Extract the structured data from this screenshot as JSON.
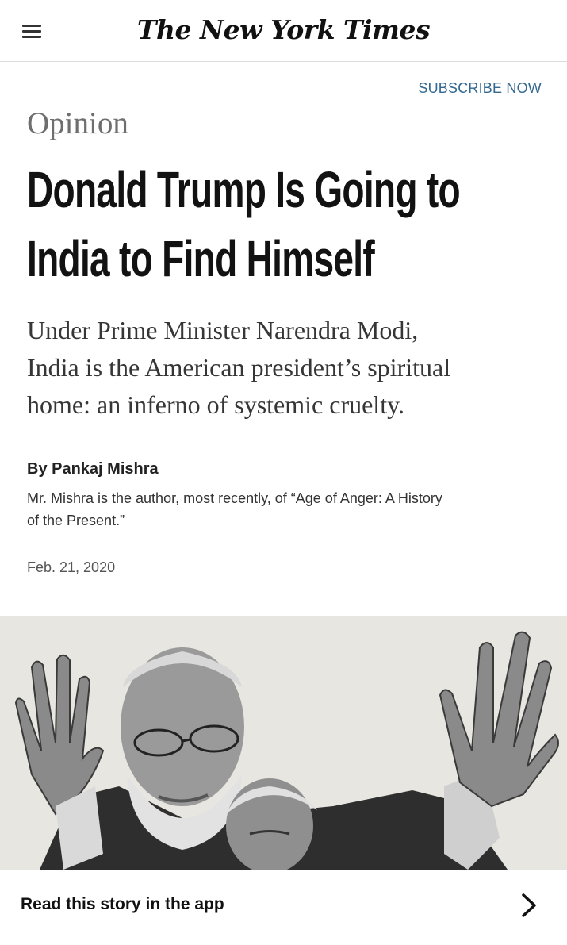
{
  "header": {
    "logo_text": "The New York Times",
    "menu_icon": "hamburger-menu-icon"
  },
  "subscribe": {
    "label": "SUBSCRIBE NOW"
  },
  "article": {
    "section": "Opinion",
    "headline_line1": "Donald Trump Is Going to",
    "headline_line2": "India to Find Himself",
    "dek_line1": "Under Prime Minister Narendra Modi,",
    "dek_line2": "India is the American president’s spiritual",
    "dek_line3": "home: an inferno of systemic cruelty.",
    "byline": "By Pankaj Mishra",
    "bio_line1": "Mr. Mishra is the author, most recently, of “Age of Anger: A History",
    "bio_line2": "of the Present.”",
    "date": "Feb. 21, 2020"
  },
  "app_banner": {
    "label": "Read this story in the app",
    "icon": "chevron-right-icon"
  },
  "colors": {
    "subscribe": "#326891",
    "section": "#6e6e6e",
    "illustration_bg": "#e8e6e1"
  }
}
